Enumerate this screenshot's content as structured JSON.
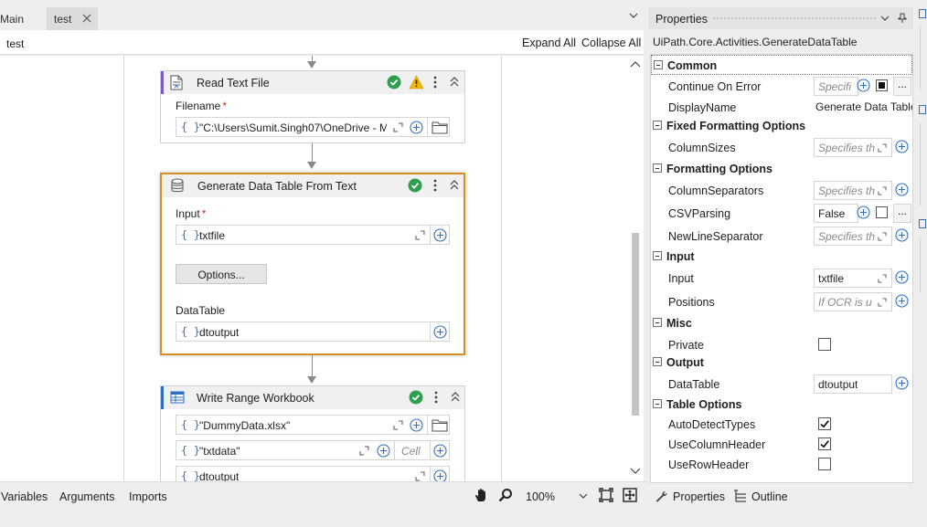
{
  "tabs": [
    {
      "label": "Main"
    },
    {
      "label": "test"
    }
  ],
  "designer": {
    "breadcrumb": "test",
    "expand_all": "Expand All",
    "collapse_all": "Collapse All"
  },
  "activities": {
    "read_text_file": {
      "title": "Read Text File",
      "filename_label": "Filename",
      "required_mark": "*",
      "filename_value": "\"C:\\Users\\Sumit.Singh07\\OneDrive - M"
    },
    "generate_table": {
      "title": "Generate Data Table From Text",
      "input_label": "Input",
      "required_mark": "*",
      "input_value": "txtfile",
      "options_button": "Options...",
      "datatable_label": "DataTable",
      "datatable_value": "dtoutput"
    },
    "write_range": {
      "title": "Write Range Workbook",
      "workbook_value": "\"DummyData.xlsx\"",
      "sheet_value": "\"txtdata\"",
      "cell_placeholder": "Cell",
      "datatable_value": "dtoutput"
    }
  },
  "bottom_bar": {
    "variables": "Variables",
    "arguments": "Arguments",
    "imports": "Imports",
    "zoom": "100%"
  },
  "properties": {
    "title": "Properties",
    "class_name": "UiPath.Core.Activities.GenerateDataTable",
    "categories": {
      "common": "Common",
      "fixed_formatting": "Fixed Formatting Options",
      "formatting": "Formatting Options",
      "input": "Input",
      "misc": "Misc",
      "output": "Output",
      "table_options": "Table Options"
    },
    "rows": {
      "continue_on_error": {
        "name": "Continue On Error",
        "value": "Specifi"
      },
      "display_name": {
        "name": "DisplayName",
        "value": "Generate Data Table"
      },
      "column_sizes": {
        "name": "ColumnSizes",
        "value": "Specifies th"
      },
      "column_separators": {
        "name": "ColumnSeparators",
        "value": "Specifies th"
      },
      "csv_parsing": {
        "name": "CSVParsing",
        "value": "False"
      },
      "new_line_separator": {
        "name": "NewLineSeparator",
        "value": "Specifies th"
      },
      "input": {
        "name": "Input",
        "value": "txtfile"
      },
      "positions": {
        "name": "Positions",
        "value": "If OCR is u"
      },
      "private": {
        "name": "Private"
      },
      "data_table": {
        "name": "DataTable",
        "value": "dtoutput"
      },
      "auto_detect_types": {
        "name": "AutoDetectTypes"
      },
      "use_column_header": {
        "name": "UseColumnHeader"
      },
      "use_row_header": {
        "name": "UseRowHeader"
      }
    },
    "checkboxes": {
      "private": false,
      "auto_detect_types": true,
      "use_column_header": true,
      "use_row_header": false
    },
    "bottom_tabs": {
      "properties": "Properties",
      "outline": "Outline"
    },
    "more_button": "..."
  },
  "colors": {
    "selected_border": "#d5911f",
    "ok_green": "#2e9e4f",
    "warn_yellow": "#f2b705",
    "brace_blue": "#2f6fc4",
    "accent_purple": "#7b5cc7",
    "accent_blue": "#2f6fc4"
  }
}
